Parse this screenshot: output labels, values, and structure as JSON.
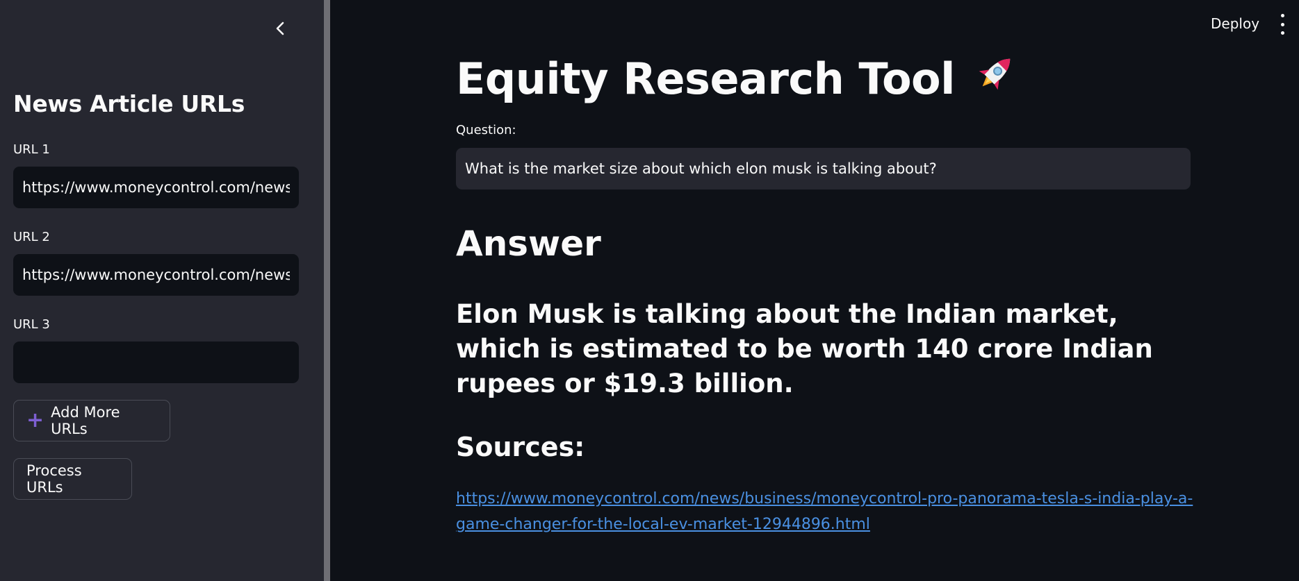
{
  "header": {
    "deploy_label": "Deploy",
    "menu_icon": "more-vertical-icon"
  },
  "sidebar": {
    "collapse_icon": "chevron-left-icon",
    "title": "News Article URLs",
    "fields": [
      {
        "label": "URL 1",
        "value": "https://www.moneycontrol.com/news/"
      },
      {
        "label": "URL 2",
        "value": "https://www.moneycontrol.com/news/"
      },
      {
        "label": "URL 3",
        "value": ""
      }
    ],
    "add_button": {
      "label": "Add More URLs",
      "icon": "plus-icon"
    },
    "process_button": {
      "label": "Process URLs"
    }
  },
  "main": {
    "title": "Equity Research Tool",
    "title_icon": "rocket-icon",
    "question_label": "Question:",
    "question_value": "What is the market size about which elon musk is talking about?",
    "answer_heading": "Answer",
    "answer_text": "Elon Musk is talking about the Indian market, which is estimated to be worth 140 crore Indian rupees or $19.3 billion.",
    "sources_heading": "Sources:",
    "source_url": "https://www.moneycontrol.com/news/business/moneycontrol-pro-panorama-tesla-s-india-play-a-game-changer-for-the-local-ev-market-12944896.html"
  },
  "colors": {
    "background": "#0e1117",
    "sidebar": "#262730",
    "link": "#4a90e2",
    "accent": "#7d5fd1"
  }
}
